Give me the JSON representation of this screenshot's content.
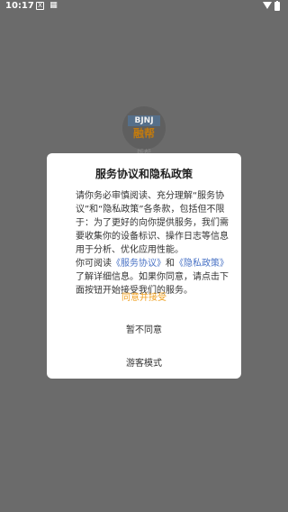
{
  "status_bar": {
    "time": "10:17",
    "icon_x": "X",
    "icon_grid": "▦"
  },
  "background_logo": {
    "line1": "BJNJ",
    "line2": "融帮",
    "caption": "版帮"
  },
  "dialog": {
    "title": "服务协议和隐私政策",
    "para1_prefix": "请你务必审慎阅读、充分理解“服务协议”和“隐私政策”各条款，包括但不限于：为了更好的向你提供服务，我们需要收集你的设备标识、操作日志等信息用于分析、优化应用性能。",
    "para2_prefix": "你可阅读",
    "link1": "《服务协议》",
    "and": "和",
    "link2": "《隐私政策》",
    "para2_suffix": "了解详细信息。如果你同意，请点击下面按钮开始接受我们的服务。",
    "agree_button": "同意并接受",
    "disagree_button": "暂不同意",
    "guest_button": "游客模式"
  },
  "colors": {
    "overlay_bg": "#6b6b6b",
    "agree": "#f0a020",
    "link": "#4a73c5"
  }
}
